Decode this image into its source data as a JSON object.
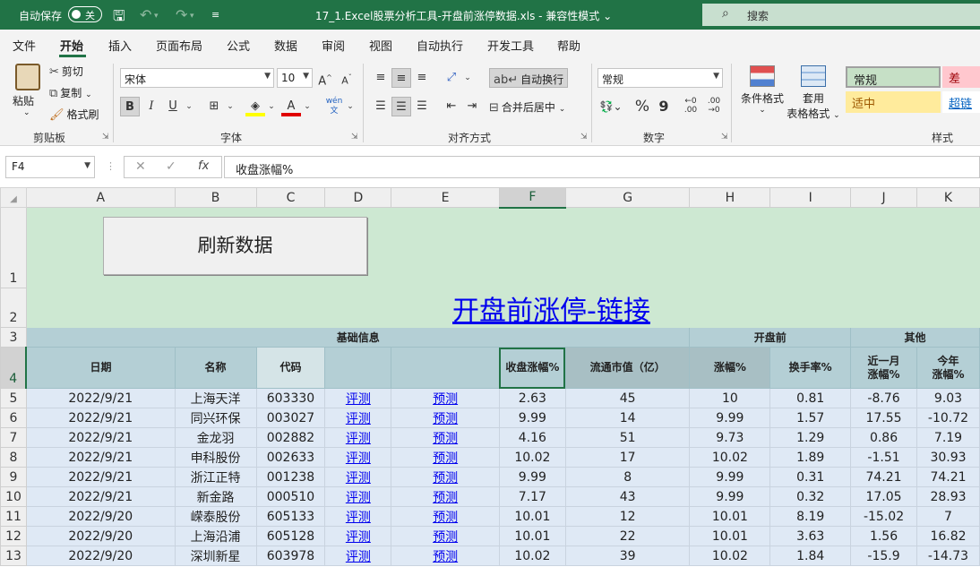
{
  "titlebar": {
    "autosave_label": "自动保存",
    "autosave_state": "关",
    "doc_title": "17_1.Excel股票分析工具-开盘前涨停数据.xls  -  兼容性模式",
    "search_placeholder": "搜索"
  },
  "ribbon_tabs": [
    "文件",
    "开始",
    "插入",
    "页面布局",
    "公式",
    "数据",
    "审阅",
    "视图",
    "自动执行",
    "开发工具",
    "帮助"
  ],
  "clipboard": {
    "paste": "粘贴",
    "cut": "剪切",
    "copy": "复制",
    "format_painter": "格式刷",
    "group": "剪贴板"
  },
  "font": {
    "name": "宋体",
    "size": "10",
    "bold": "B",
    "italic": "I",
    "underline": "U",
    "group": "字体"
  },
  "alignment": {
    "wrap": "自动换行",
    "merge": "合并后居中",
    "group": "对齐方式"
  },
  "number": {
    "format": "常规",
    "percent": "%",
    "comma": "9",
    "group": "数字"
  },
  "styles": {
    "conditional": "条件格式",
    "table_line1": "套用",
    "table_line2": "表格格式",
    "normal": "常规",
    "bad": "差",
    "neutral": "适中",
    "hyperlink": "超链接",
    "group": "样式",
    "colors": {
      "normal": "#c6e0c6",
      "bad": "#ffc7ce",
      "neutral": "#ffeb9c"
    }
  },
  "formula_bar": {
    "cell_ref": "F4",
    "content": "收盘涨幅%"
  },
  "sheet": {
    "columns": [
      "A",
      "B",
      "C",
      "D",
      "E",
      "F",
      "G",
      "H",
      "I",
      "J",
      "K"
    ],
    "rows": [
      "1",
      "2",
      "3",
      "4",
      "5",
      "6",
      "7",
      "8",
      "9",
      "10",
      "11",
      "12",
      "13"
    ],
    "refresh_button": "刷新数据",
    "title_link": "开盘前涨停-链接",
    "groups": {
      "basic": "基础信息",
      "pre_open": "开盘前",
      "other": "其他"
    },
    "headers": {
      "date": "日期",
      "name": "名称",
      "code": "代码",
      "close_pct": "收盘涨幅%",
      "float_cap": "流通市值（亿）",
      "chg_pct": "涨幅%",
      "turnover": "换手率%",
      "month_l1": "近一月",
      "month_l2": "涨幅%",
      "year_l1": "今年",
      "year_l2": "涨幅%"
    },
    "data": [
      [
        "2022/9/21",
        "上海天洋",
        "603330",
        "评测",
        "预测",
        "2.63",
        "45",
        "10",
        "0.81",
        "-8.76",
        "9.03"
      ],
      [
        "2022/9/21",
        "同兴环保",
        "003027",
        "评测",
        "预测",
        "9.99",
        "14",
        "9.99",
        "1.57",
        "17.55",
        "-10.72"
      ],
      [
        "2022/9/21",
        "金龙羽",
        "002882",
        "评测",
        "预测",
        "4.16",
        "51",
        "9.73",
        "1.29",
        "0.86",
        "7.19"
      ],
      [
        "2022/9/21",
        "申科股份",
        "002633",
        "评测",
        "预测",
        "10.02",
        "17",
        "10.02",
        "1.89",
        "-1.51",
        "30.93"
      ],
      [
        "2022/9/21",
        "浙江正特",
        "001238",
        "评测",
        "预测",
        "9.99",
        "8",
        "9.99",
        "0.31",
        "74.21",
        "74.21"
      ],
      [
        "2022/9/21",
        "新金路",
        "000510",
        "评测",
        "预测",
        "7.17",
        "43",
        "9.99",
        "0.32",
        "17.05",
        "28.93"
      ],
      [
        "2022/9/20",
        "嵘泰股份",
        "605133",
        "评测",
        "预测",
        "10.01",
        "12",
        "10.01",
        "8.19",
        "-15.02",
        "7"
      ],
      [
        "2022/9/20",
        "上海沿浦",
        "605128",
        "评测",
        "预测",
        "10.01",
        "22",
        "10.01",
        "3.63",
        "1.56",
        "16.82"
      ],
      [
        "2022/9/20",
        "深圳新星",
        "603978",
        "评测",
        "预测",
        "10.02",
        "39",
        "10.02",
        "1.84",
        "-15.9",
        "-14.73"
      ]
    ]
  }
}
